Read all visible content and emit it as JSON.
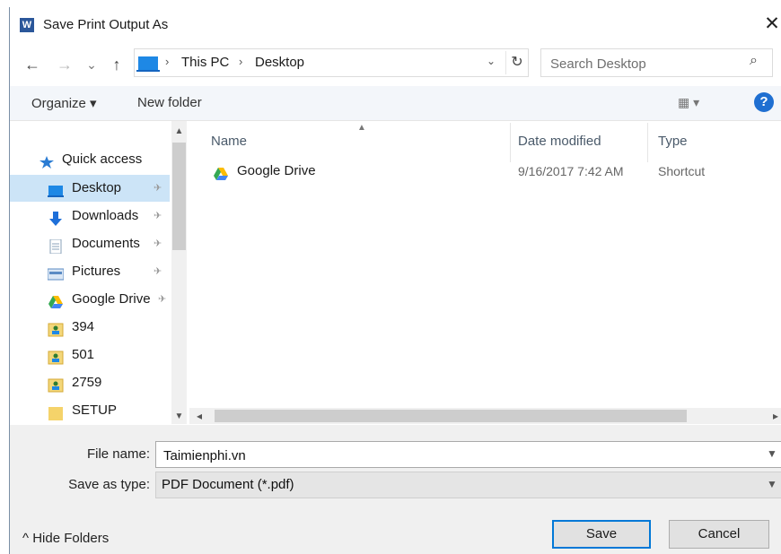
{
  "window": {
    "title": "Save Print Output As",
    "app_icon_letter": "W",
    "close_glyph": "✕"
  },
  "address_bar": {
    "back_glyph": "←",
    "forward_glyph": "→",
    "recent_glyph": "⌄",
    "up_glyph": "↑",
    "separator_glyph": "›",
    "crumbs": [
      "This PC",
      "Desktop"
    ],
    "dropdown_glyph": "⌄",
    "refresh_glyph": "↻"
  },
  "search": {
    "placeholder": "Search Desktop",
    "icon_glyph": "⌕"
  },
  "toolbar": {
    "organize_label": "Organize ▾",
    "new_folder_label": "New folder",
    "view_glyph": "▦ ▾",
    "help_glyph": "?"
  },
  "nav_pane": {
    "pin_glyph": "✈",
    "items": [
      {
        "label": "Quick access",
        "icon": "star-icon",
        "color": "#2b7cd3"
      },
      {
        "label": "Desktop",
        "icon": "desktop-icon",
        "color": "#1e88e5"
      },
      {
        "label": "Downloads",
        "icon": "download-arrow-icon",
        "color": "#1e6fd9"
      },
      {
        "label": "Documents",
        "icon": "document-icon",
        "color": "#8aa0b8"
      },
      {
        "label": "Pictures",
        "icon": "picture-icon",
        "color": "#5b8bc4"
      },
      {
        "label": "Google Drive",
        "icon": "google-drive-icon",
        "color": "#34a853"
      },
      {
        "label": "394",
        "icon": "folder-image-icon",
        "color": "#e8c15a"
      },
      {
        "label": "501",
        "icon": "folder-image-icon",
        "color": "#e8c15a"
      },
      {
        "label": "2759",
        "icon": "folder-image-icon",
        "color": "#e8c15a"
      },
      {
        "label": "SETUP",
        "icon": "folder-icon",
        "color": "#f5d36a"
      }
    ]
  },
  "file_list": {
    "columns": [
      "Name",
      "Date modified",
      "Type"
    ],
    "rows": [
      {
        "name": "Google Drive",
        "date_modified": "9/16/2017 7:42 AM",
        "type": "Shortcut"
      }
    ]
  },
  "form": {
    "file_name_label": "File name:",
    "file_name_value": "Taimienphi.vn",
    "save_type_label": "Save as type:",
    "save_type_value": "PDF Document (*.pdf)"
  },
  "footer": {
    "hide_folders_label": "^  Hide Folders",
    "save_label": "Save",
    "cancel_label": "Cancel"
  },
  "colors": {
    "selection": "#cce4f7",
    "accent": "#0078d7",
    "toolbar_bg": "#f3f6fa",
    "bottom_bg": "#f0f0f0"
  }
}
